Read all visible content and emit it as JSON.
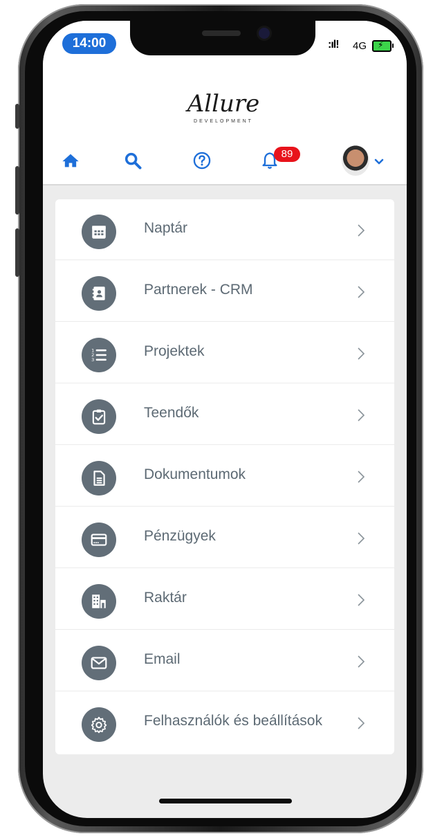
{
  "status_bar": {
    "time": "14:00",
    "signal": ":ıl!",
    "network": "4G",
    "battery_charging": true
  },
  "header": {
    "logo_text": "Allure",
    "logo_subtext": "DEVELOPMENT",
    "nav": [
      {
        "icon": "home-icon"
      },
      {
        "icon": "search-icon"
      },
      {
        "icon": "help-icon"
      },
      {
        "icon": "bell-icon"
      }
    ],
    "notification_count": "89",
    "accent_color": "#1e6fd9",
    "badge_color": "#e8131b"
  },
  "menu": {
    "items": [
      {
        "label": "Naptár",
        "icon": "calendar-icon"
      },
      {
        "label": "Partnerek - CRM",
        "icon": "contact-card-icon"
      },
      {
        "label": "Projektek",
        "icon": "list-numbered-icon"
      },
      {
        "label": "Teendők",
        "icon": "clipboard-check-icon"
      },
      {
        "label": "Dokumentumok",
        "icon": "document-icon"
      },
      {
        "label": "Pénzügyek",
        "icon": "credit-card-icon"
      },
      {
        "label": "Raktár",
        "icon": "warehouse-icon"
      },
      {
        "label": "Email",
        "icon": "envelope-icon"
      },
      {
        "label": "Felhasználók és beállítások",
        "icon": "gear-icon"
      }
    ],
    "icon_color": "#626e78",
    "label_color": "#5d6a74"
  }
}
